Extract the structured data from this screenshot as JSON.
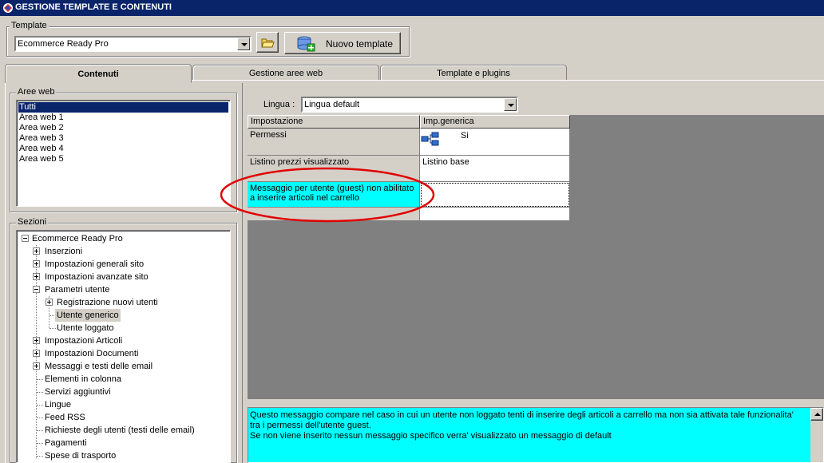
{
  "window": {
    "title": "GESTIONE TEMPLATE E CONTENUTI",
    "icon": "app-logo-icon"
  },
  "template_group": {
    "legend": "Template",
    "selected": "Ecommerce Ready Pro",
    "folder_icon": "folder-open-icon",
    "new_button_label": "Nuovo template",
    "new_button_icon": "database-add-icon"
  },
  "tabs": [
    {
      "label": "Contenuti",
      "active": true
    },
    {
      "label": "Gestione aree web",
      "active": false
    },
    {
      "label": "Template e plugins",
      "active": false
    }
  ],
  "aree_web": {
    "legend": "Aree web",
    "items": [
      "Tutti",
      "Area web 1",
      "Area web 2",
      "Area web 3",
      "Area web 4",
      "Area web 5"
    ],
    "selected_index": 0
  },
  "sezioni": {
    "legend": "Sezioni",
    "root": "Ecommerce Ready Pro",
    "nodes": [
      "Inserzioni",
      "Impostazioni generali sito",
      "Impostazioni avanzate sito",
      "Parametri utente",
      "Registrazione nuovi utenti",
      "Utente generico",
      "Utente loggato",
      "Impostazioni Articoli",
      "Impostazioni Documenti",
      "Messaggi e testi delle email",
      "Elementi in colonna",
      "Servizi aggiuntivi",
      "Lingue",
      "Feed RSS",
      "Richieste degli utenti (testi delle email)",
      "Pagamenti",
      "Spese di trasporto"
    ],
    "selected": "Utente generico"
  },
  "lingua": {
    "label": "Lingua :",
    "selected": "Lingua default"
  },
  "grid": {
    "headers": [
      "Impostazione",
      "Imp.generica"
    ],
    "rows": [
      {
        "setting": "Permessi",
        "value": "Si",
        "icon": "permissions-tree-icon"
      },
      {
        "setting": "Listino prezzi visualizzato",
        "value": "Listino base"
      },
      {
        "setting": "Messaggio per utente (guest) non abilitato a inserire articoli nel carrello",
        "value": ""
      }
    ],
    "highlight_color": "#00ffff",
    "annotation_color": "#e00000"
  },
  "description": {
    "line1": "Questo messaggio compare nel caso in cui un utente non loggato tenti di inserire degli articoli a carrello ma non sia attivata tale funzionalita' tra i permessi dell'utente guest.",
    "line2": "Se non viene inserito nessun messaggio specifico verra' visualizzato un messaggio di default"
  }
}
